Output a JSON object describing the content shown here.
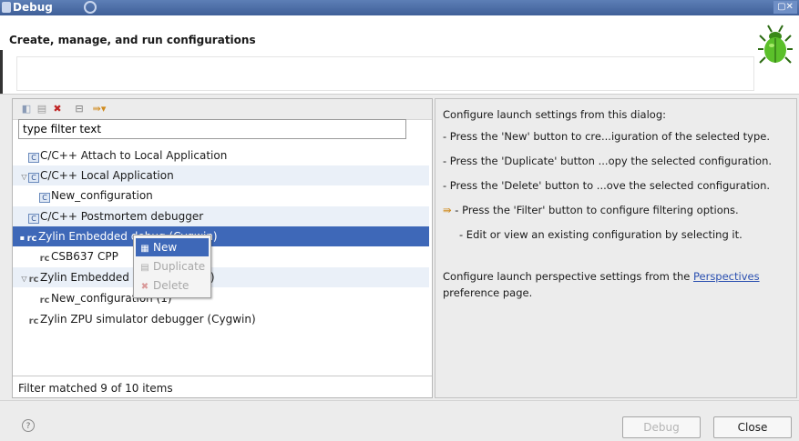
{
  "window": {
    "title": "Debug"
  },
  "header": {
    "title": "Create, manage, and run configurations"
  },
  "toolbar": {
    "icons": [
      "new-launch-config-icon",
      "duplicate-icon",
      "delete-icon",
      "collapse-all-icon",
      "filter-icon"
    ]
  },
  "filter": {
    "placeholder": "type filter text",
    "value": "type filter text"
  },
  "tree": {
    "items": [
      {
        "label": "C/C++ Attach to Local Application"
      },
      {
        "label": "C/C++ Local Application"
      },
      {
        "label": "New_configuration"
      },
      {
        "label": "C/C++ Postmortem debugger"
      },
      {
        "label": "Zylin Embedded debug (Cygwin)"
      },
      {
        "label": "CSB637  CPP"
      },
      {
        "label": "Zylin Embedded debug (Native)"
      },
      {
        "label": "New_configuration (1)"
      },
      {
        "label": "Zylin ZPU simulator debugger (Cygwin)"
      }
    ]
  },
  "status": {
    "text": "Filter matched 9 of 10 items"
  },
  "context_menu": {
    "new": "New",
    "duplicate": "Duplicate",
    "delete": "Delete"
  },
  "right": {
    "intro": "Configure launch settings from this dialog:",
    "lines": [
      "- Press the 'New' button to cre...iguration of the selected type.",
      "- Press the 'Duplicate' button ...opy the selected configuration.",
      "- Press the 'Delete' button to ...ove the selected configuration.",
      "- Press the 'Filter' button to configure filtering options.",
      "- Edit or view an existing configuration by selecting it."
    ],
    "persp_prefix": "Configure launch perspective settings from the ",
    "persp_link": "Perspectives",
    "persp_suffix": "preference page."
  },
  "buttons": {
    "debug": "Debug",
    "close": "Close"
  },
  "colors": {
    "selection": "#3e68b8",
    "titlebar": "#4a6ca8",
    "link": "#2a4fb0"
  }
}
